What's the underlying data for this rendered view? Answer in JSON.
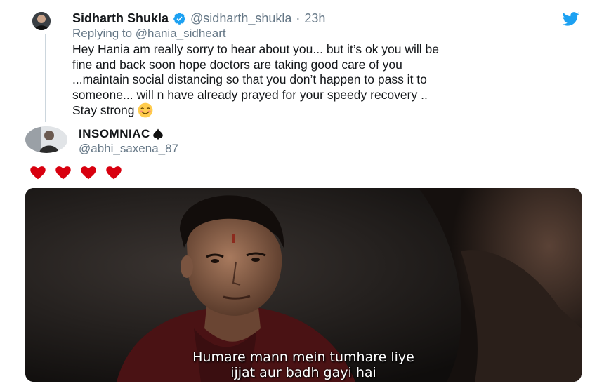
{
  "quoted_tweet": {
    "display_name": "Sidharth Shukla",
    "handle": "@sidharth_shukla",
    "separator": "·",
    "time": "23h",
    "replying_prefix": "Replying to",
    "replying_to": "@hania_sidheart",
    "body_lines": [
      "Hey Hania am really sorry to hear about you... but it’s ok you will be",
      "fine and back soon hope doctors are taking good care of you",
      "...maintain social distancing so that you don’t happen to pass it to",
      "someone... will n have already prayed for your speedy recovery ..",
      "Stay strong"
    ],
    "trailing_emoji": "smiling-face-icon",
    "brand_icon": "twitter-bird-icon"
  },
  "tweet": {
    "display_name": "INSOMNIAC",
    "name_emoji": "spade-suit-icon",
    "handle": "@abhi_saxena_87",
    "hearts_count": 4,
    "heart_color": "#d8000f"
  },
  "media": {
    "subtitle_lines": [
      "Humare mann mein tumhare liye",
      "ijjat aur badh gayi hai"
    ]
  },
  "colors": {
    "text": "#14171a",
    "secondary": "#657786",
    "twitter_blue": "#1da1f2",
    "thread_line": "#ccd6dd"
  }
}
